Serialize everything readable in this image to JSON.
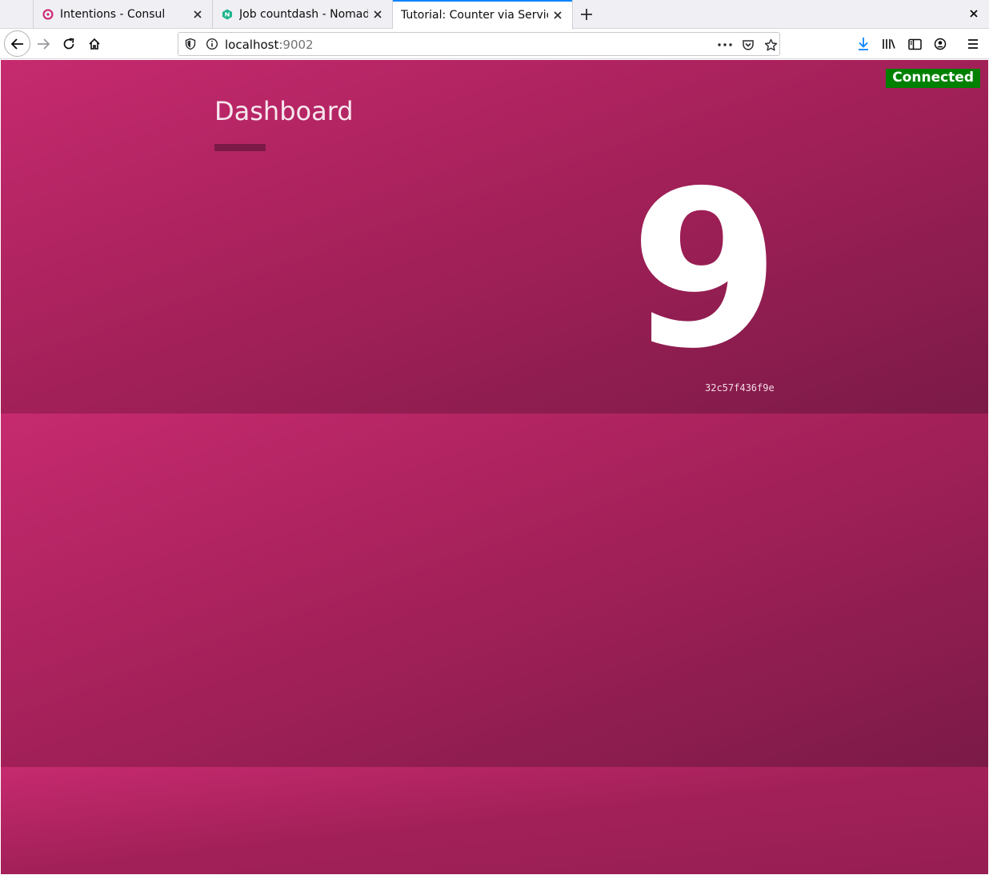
{
  "browser": {
    "tabs": [
      {
        "title": "Intentions - Consul",
        "icon": "consul-icon",
        "active": false
      },
      {
        "title": "Job countdash - Nomad",
        "icon": "nomad-icon",
        "active": false
      },
      {
        "title": "Tutorial: Counter via Service",
        "icon": "",
        "active": true
      }
    ],
    "url": {
      "host": "localhost",
      "port": ":9002"
    },
    "accent_color": "#0a84ff",
    "download_color": "#0a84ff"
  },
  "page": {
    "status": "Connected",
    "status_color": "#008000",
    "title": "Dashboard",
    "count": "9",
    "hostname": "32c57f436f9e",
    "background_colors": [
      "#c62a6f",
      "#7b1a47"
    ]
  }
}
